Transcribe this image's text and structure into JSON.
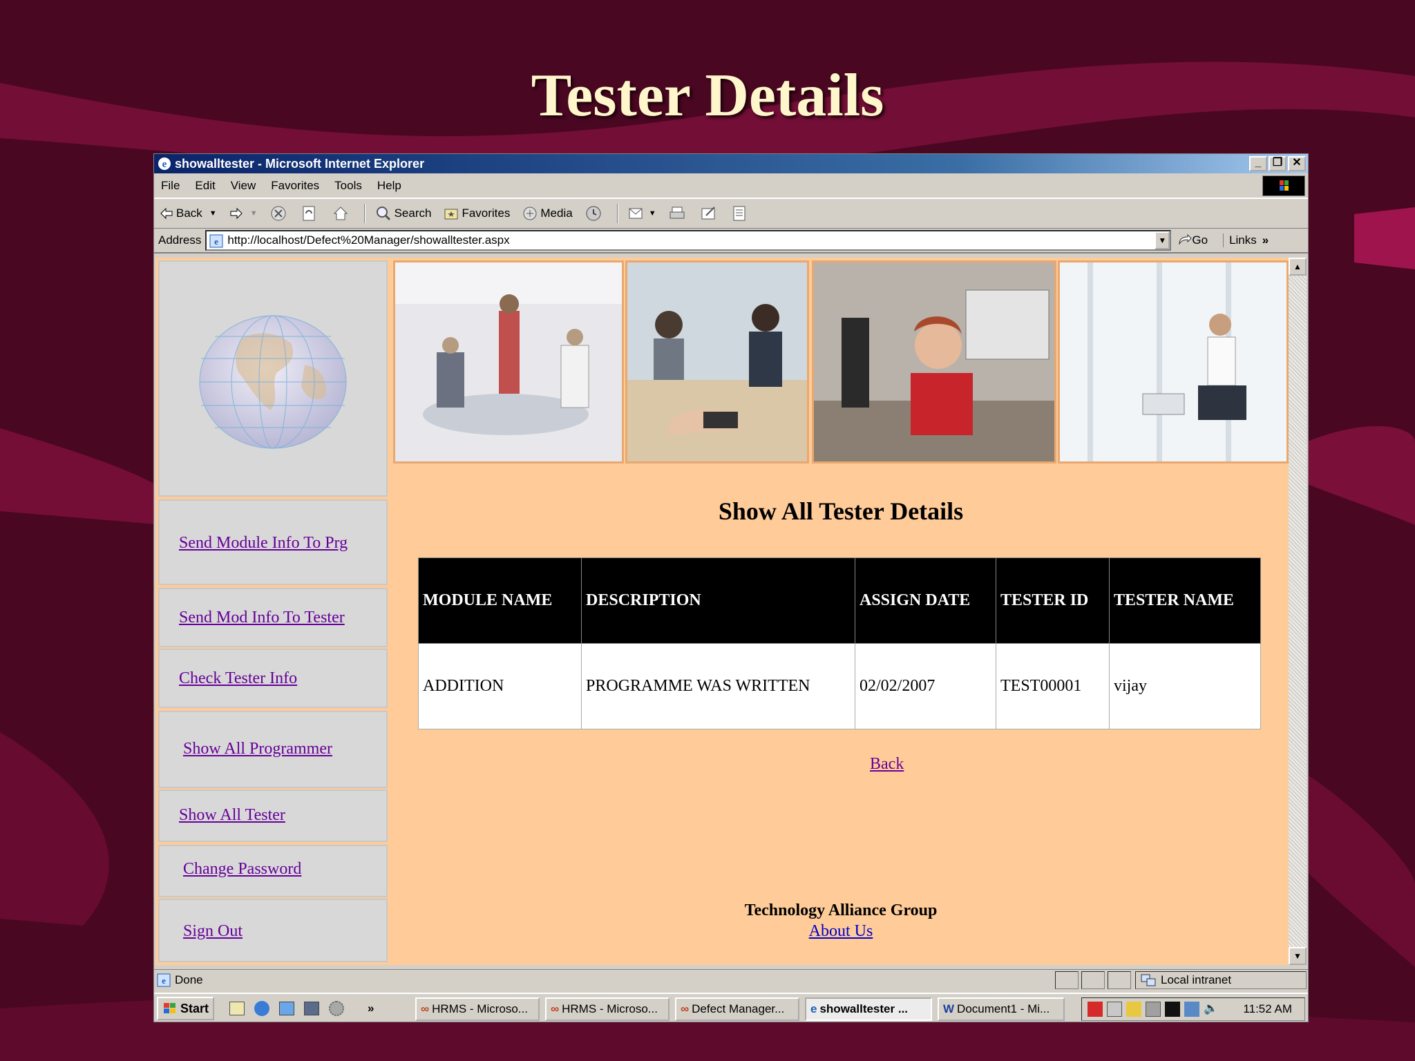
{
  "slide": {
    "title": "Tester Details"
  },
  "window": {
    "title": "showalltester - Microsoft Internet Explorer",
    "buttons": {
      "minimize": "_",
      "restore": "❐",
      "close": "✕"
    }
  },
  "menu": [
    "File",
    "Edit",
    "View",
    "Favorites",
    "Tools",
    "Help"
  ],
  "toolbar": {
    "back": "Back",
    "search": "Search",
    "favorites": "Favorites",
    "media": "Media"
  },
  "address": {
    "label": "Address",
    "url": "http://localhost/Defect%20Manager/showalltester.aspx",
    "go": "Go",
    "links": "Links"
  },
  "sidebar": {
    "items": [
      "Send Module Info To Prg",
      "Send Mod Info To Tester",
      "Check Tester Info",
      "Show All Programmer",
      "Show All Tester",
      "Change Password",
      "Sign Out"
    ]
  },
  "main": {
    "heading": "Show All Tester Details",
    "table": {
      "headers": [
        "MODULE NAME",
        "DESCRIPTION",
        "ASSIGN DATE",
        "TESTER ID",
        "TESTER NAME"
      ],
      "rows": [
        [
          "ADDITION",
          "PROGRAMME WAS WRITTEN",
          "02/02/2007",
          "TEST00001",
          "vijay"
        ]
      ]
    },
    "back_link": "Back",
    "footer_org": "Technology Alliance Group",
    "footer_about": "About Us"
  },
  "status": {
    "text": "Done",
    "zone": "Local intranet"
  },
  "taskbar": {
    "start": "Start",
    "tasks": [
      "HRMS - Microso...",
      "HRMS - Microso...",
      "Defect Manager...",
      "showalltester ...",
      "Document1 - Mi..."
    ],
    "clock": "11:52 AM"
  },
  "colors": {
    "slide_bg": "#4a0722",
    "title_text": "#fff6cc",
    "page_bg": "#ffcc99",
    "link": "#660099",
    "table_header_bg": "#000000"
  }
}
